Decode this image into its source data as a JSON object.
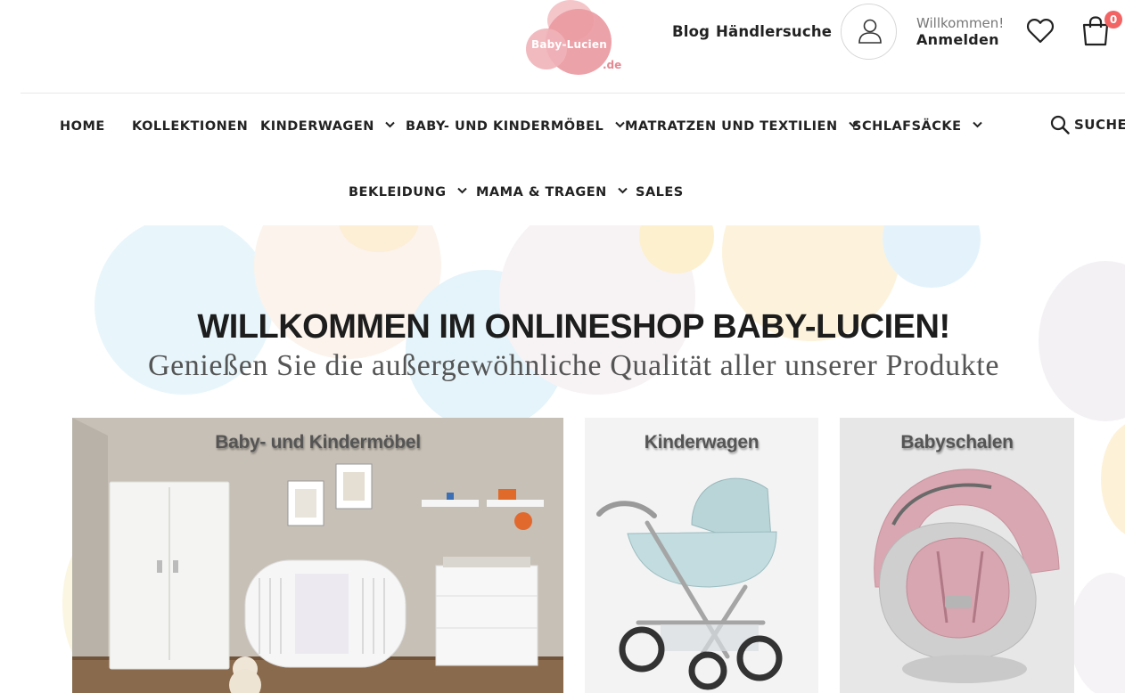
{
  "header": {
    "logo_text": "Baby-Lucien",
    "logo_tld": ".de",
    "links": [
      "Blog",
      "Händlersuche"
    ],
    "account": {
      "welcome": "Willkommen!",
      "login": "Anmelden"
    },
    "cart_count": "0",
    "icons": {
      "account": "user-icon",
      "wishlist": "heart-icon",
      "cart": "shopping-bag-icon"
    }
  },
  "nav": {
    "row1": [
      {
        "label": "HOME",
        "dropdown": false
      },
      {
        "label": "KOLLEKTIONEN",
        "dropdown": false
      },
      {
        "label": "KINDERWAGEN",
        "dropdown": true
      },
      {
        "label": "BABY- UND KINDERMÖBEL",
        "dropdown": true
      },
      {
        "label": "MATRATZEN UND TEXTILIEN",
        "dropdown": true
      },
      {
        "label": "SCHLAFSÄCKE",
        "dropdown": true
      }
    ],
    "row2": [
      {
        "label": "BEKLEIDUNG",
        "dropdown": true
      },
      {
        "label": "MAMA & TRAGEN",
        "dropdown": true
      },
      {
        "label": "SALES",
        "dropdown": false
      }
    ],
    "search_label": "SUCHE"
  },
  "hero": {
    "title": "WILLKOMMEN IM ONLINESHOP BABY-LUCIEN!",
    "subtitle": "Genießen Sie die außergewöhnliche Qualität aller unserer Produkte"
  },
  "categories": [
    {
      "label": "Baby- und Kindermöbel"
    },
    {
      "label": "Kinderwagen"
    },
    {
      "label": "Babyschalen"
    }
  ],
  "colors": {
    "accent_pink": "#ea9aa2",
    "badge_red": "#f26464",
    "text_dark": "#222222"
  }
}
